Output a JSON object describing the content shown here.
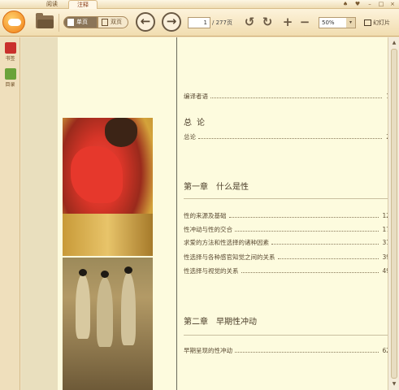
{
  "window": {
    "tabs": [
      "阅读",
      "注释"
    ],
    "controls": [
      "♠",
      "♥",
      "–",
      "□",
      "×"
    ]
  },
  "toolbar": {
    "single_page_label": "单页",
    "double_page_label": "双页",
    "back_arrow": "←",
    "forward_arrow": "→",
    "current_page": "1",
    "total_pages": "/ 277页",
    "rotate_left": "↺",
    "rotate_right": "↻",
    "zoom_in": "+",
    "zoom_out": "−",
    "zoom_value": "50%",
    "zoom_arrow": "▾",
    "slideshow_label": "幻灯片"
  },
  "sidebar": {
    "items": [
      {
        "label": "书签",
        "icon": "bookmark-icon",
        "color": "#c9302c"
      },
      {
        "label": "目录",
        "icon": "toc-icon",
        "color": "#6aa339"
      }
    ]
  },
  "scrollbar": {
    "up": "▲",
    "down": "▼"
  },
  "toc": {
    "preface": {
      "title": "编译者语",
      "page": "1"
    },
    "general": {
      "heading": "总论",
      "entries": [
        {
          "title": "总论",
          "page": "2"
        }
      ]
    },
    "chapter1": {
      "heading": "第一章　什么是性",
      "entries": [
        {
          "title": "性的来源及基础",
          "page": "12"
        },
        {
          "title": "性冲动与性的交合",
          "page": "17"
        },
        {
          "title": "求爱的方法和性选择的诸种因素",
          "page": "31"
        },
        {
          "title": "性选择与各种感官知觉之间的关系",
          "page": "39"
        },
        {
          "title": "性选择与视觉的关系",
          "page": "49"
        }
      ]
    },
    "chapter2": {
      "heading": "第二章　早期性冲动",
      "entries": [
        {
          "title": "早期呈现的性冲动",
          "page": "62"
        }
      ]
    }
  }
}
